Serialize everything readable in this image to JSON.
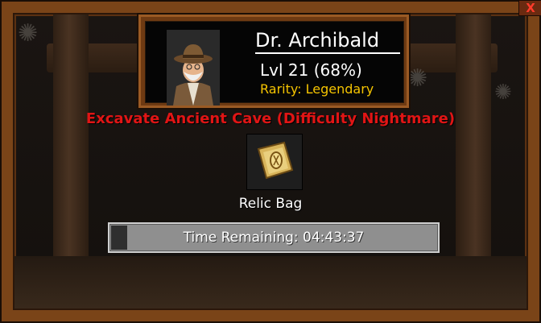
{
  "hero": {
    "name": "Dr. Archibald",
    "level_text": "Lvl 21 (68%)",
    "rarity_text": "Rarity: Legendary",
    "avatar_icon": "explorer-portrait-icon"
  },
  "mission": {
    "title": "Excavate Ancient Cave (Difficulty Nightmare)"
  },
  "reward": {
    "label": "Relic Bag",
    "icon": "relic-bag-icon"
  },
  "timer": {
    "text": "Time Remaining: 04:43:37",
    "progress": 0.05
  },
  "close_button": {
    "label": "X"
  },
  "colors": {
    "frame": "#7a4418",
    "title_red": "#e01515",
    "rarity_gold": "#f5c400"
  }
}
